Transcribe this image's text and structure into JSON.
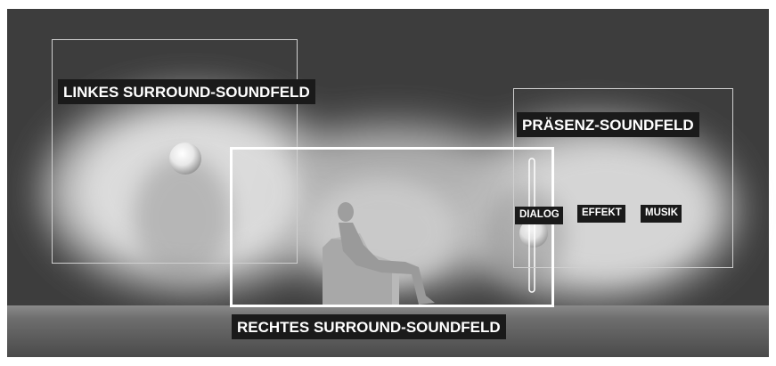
{
  "labels": {
    "left_surround": "LINKES SURROUND-SOUNDFELD",
    "presence": "PRÄSENZ-SOUNDFELD",
    "right_surround": "RECHTES SURROUND-SOUNDFELD",
    "dialog": "DIALOG",
    "effect": "EFFEKT",
    "music": "MUSIK"
  },
  "colors": {
    "background": "#3d3d3d",
    "floor": "#6a6a6a",
    "field_glow": "#d9d9d9",
    "label_bg": "#1a1a1a",
    "label_text": "#ffffff"
  }
}
